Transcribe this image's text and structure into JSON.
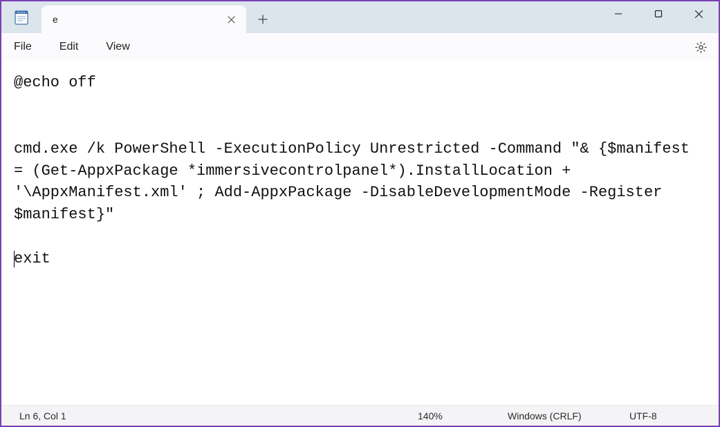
{
  "titlebar": {
    "tab_title": "e"
  },
  "menu": {
    "file": "File",
    "edit": "Edit",
    "view": "View"
  },
  "editor": {
    "content": "@echo off\n\n\ncmd.exe /k PowerShell -ExecutionPolicy Unrestricted -Command \"& {$manifest = (Get-AppxPackage *immersivecontrolpanel*).InstallLocation + '\\AppxManifest.xml' ; Add-AppxPackage -DisableDevelopmentMode -Register $manifest}\"\n\n",
    "lastline": "exit"
  },
  "statusbar": {
    "position": "Ln 6, Col 1",
    "zoom": "140%",
    "eol": "Windows (CRLF)",
    "encoding": "UTF-8"
  }
}
